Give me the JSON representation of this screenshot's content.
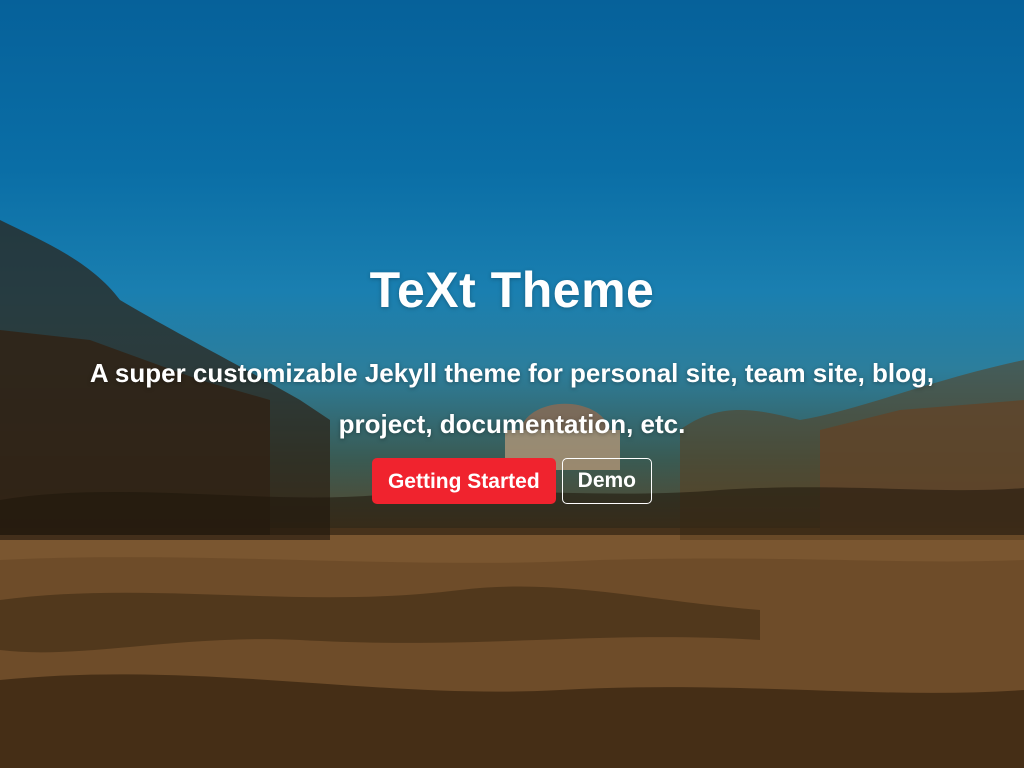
{
  "hero": {
    "title": "TeXt Theme",
    "subtitle": "A super customizable Jekyll theme for personal site, team site, blog, project, documentation, etc.",
    "buttons": {
      "primary_label": "Getting Started",
      "secondary_label": "Demo"
    }
  },
  "colors": {
    "sky": "#0a6ea6",
    "primary_button": "#f0232e",
    "text": "#ffffff"
  }
}
